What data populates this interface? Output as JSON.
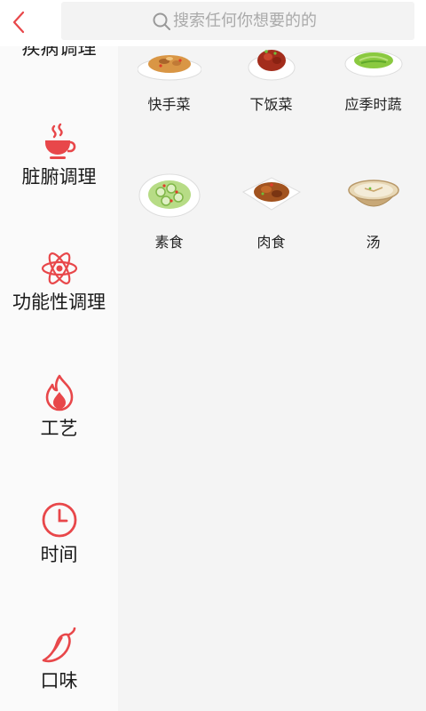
{
  "header": {
    "search_placeholder": "搜索任何你想要的的"
  },
  "sidebar": {
    "items": [
      {
        "label": "疾病调理",
        "icon": "disease-icon"
      },
      {
        "label": "脏腑调理",
        "icon": "teacup-icon"
      },
      {
        "label": "功能性调理",
        "icon": "atom-icon"
      },
      {
        "label": "工艺",
        "icon": "flame-icon"
      },
      {
        "label": "时间",
        "icon": "clock-icon"
      },
      {
        "label": "口味",
        "icon": "chili-icon"
      }
    ]
  },
  "categories": [
    {
      "label": "快手菜",
      "icon": "stir-fry-dish-icon"
    },
    {
      "label": "下饭菜",
      "icon": "braised-dish-icon"
    },
    {
      "label": "应季时蔬",
      "icon": "greens-dish-icon"
    },
    {
      "label": "素食",
      "icon": "cucumber-dish-icon"
    },
    {
      "label": "肉食",
      "icon": "meat-dish-icon"
    },
    {
      "label": "汤",
      "icon": "soup-icon"
    }
  ],
  "colors": {
    "accent": "#e8474a",
    "sidebar_bg": "#fafafa",
    "content_bg": "#f4f4f4"
  }
}
